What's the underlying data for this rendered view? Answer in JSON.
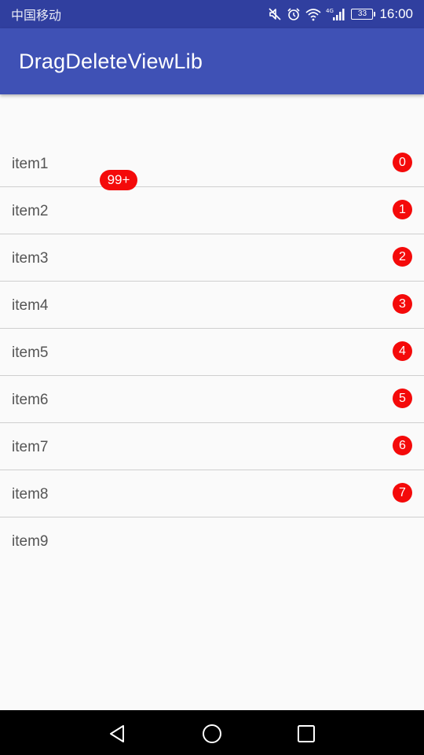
{
  "status_bar": {
    "carrier": "中国移动",
    "network": "4G",
    "battery_level": "33",
    "time": "16:00",
    "icons": [
      "mute-icon",
      "alarm-icon",
      "wifi-icon",
      "signal-icon",
      "battery-icon"
    ],
    "background_color": "#303f9f"
  },
  "app_bar": {
    "title": "DragDeleteViewLib",
    "background_color": "#3f51b5"
  },
  "list": {
    "items": [
      {
        "label": "item1",
        "badge": "0"
      },
      {
        "label": "item2",
        "badge": "1"
      },
      {
        "label": "item3",
        "badge": "2"
      },
      {
        "label": "item4",
        "badge": "3"
      },
      {
        "label": "item5",
        "badge": "4"
      },
      {
        "label": "item6",
        "badge": "5"
      },
      {
        "label": "item7",
        "badge": "6"
      },
      {
        "label": "item8",
        "badge": "7"
      },
      {
        "label": "item9",
        "badge": null
      }
    ],
    "badge_color": "#f40a0a"
  },
  "drag_badge": {
    "text": "99+"
  },
  "nav_bar": {
    "icons": [
      "back-icon",
      "home-icon",
      "recents-icon"
    ]
  }
}
